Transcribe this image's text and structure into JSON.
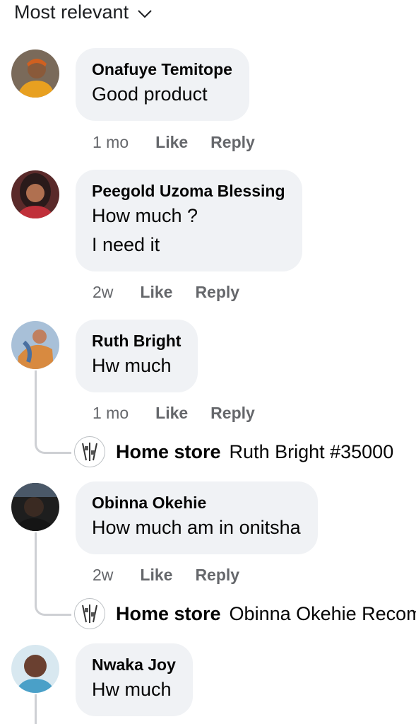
{
  "sort": {
    "label": "Most relevant",
    "icon": "chevron-down-icon"
  },
  "comments": [
    {
      "author": "Onafuye Temitope",
      "lines": [
        "Good product"
      ],
      "time": "1 mo",
      "like": "Like",
      "reply": "Reply",
      "avatar_colors": [
        "#6b5a4a",
        "#e8a020"
      ]
    },
    {
      "author": "Peegold Uzoma Blessing",
      "lines": [
        "How much ?",
        "I need it"
      ],
      "time": "2w",
      "like": "Like",
      "reply": "Reply",
      "avatar_colors": [
        "#7a2a2a",
        "#c0303a"
      ]
    },
    {
      "author": "Ruth Bright",
      "lines": [
        "Hw much"
      ],
      "time": "1 mo",
      "like": "Like",
      "reply": "Reply",
      "avatar_colors": [
        "#9fb8d0",
        "#d08040"
      ],
      "page_reply": {
        "name": "Home store",
        "text": "Ruth Bright #35000"
      }
    },
    {
      "author": "Obinna Okehie",
      "lines": [
        "How much am in onitsha"
      ],
      "time": "2w",
      "like": "Like",
      "reply": "Reply",
      "avatar_colors": [
        "#2a2a2a",
        "#556070"
      ],
      "page_reply": {
        "name": "Home store",
        "text": "Obinna Okehie Recommended"
      }
    },
    {
      "author": "Nwaka Joy",
      "lines": [
        "Hw much"
      ],
      "avatar_colors": [
        "#4aa0c8",
        "#6a4030"
      ]
    }
  ]
}
